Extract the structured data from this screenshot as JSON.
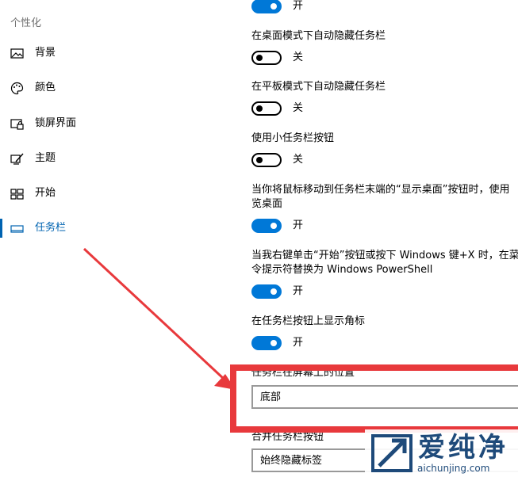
{
  "sidebar": {
    "section_title": "个性化",
    "items": [
      {
        "label": "背景",
        "icon": "picture-icon"
      },
      {
        "label": "颜色",
        "icon": "palette-icon"
      },
      {
        "label": "锁屏界面",
        "icon": "lock-screen-icon"
      },
      {
        "label": "主题",
        "icon": "theme-brush-icon"
      },
      {
        "label": "开始",
        "icon": "start-grid-icon"
      },
      {
        "label": "任务栏",
        "icon": "taskbar-icon",
        "active": true
      }
    ]
  },
  "taskbar_settings": {
    "top_toggle_state": "开",
    "desktop_autohide": {
      "title": "在桌面模式下自动隐藏任务栏",
      "state": "关"
    },
    "tablet_autohide": {
      "title": "在平板模式下自动隐藏任务栏",
      "state": "关"
    },
    "small_buttons": {
      "title": "使用小任务栏按钮",
      "state": "关"
    },
    "peek": {
      "title_line1": "当你将鼠标移动到任务栏末端的“显示桌面”按钮时，使用",
      "title_line2": "览桌面",
      "state": "开"
    },
    "powershell": {
      "title_line1": "当我右键单击“开始”按钮或按下 Windows 键+X 时，在菜",
      "title_line2": "令提示符替换为 Windows PowerShell",
      "state": "开"
    },
    "badges": {
      "title": "在任务栏按钮上显示角标",
      "state": "开"
    },
    "location": {
      "title": "任务栏在屏幕上的位置",
      "value": "底部"
    },
    "combine": {
      "title": "合并任务栏按钮",
      "value": "始终隐藏标签"
    }
  },
  "watermark": {
    "text": "爱纯净",
    "url": "aichunjing.com"
  },
  "colors": {
    "accent": "#0078d7",
    "annotation_red": "#e8393c"
  }
}
